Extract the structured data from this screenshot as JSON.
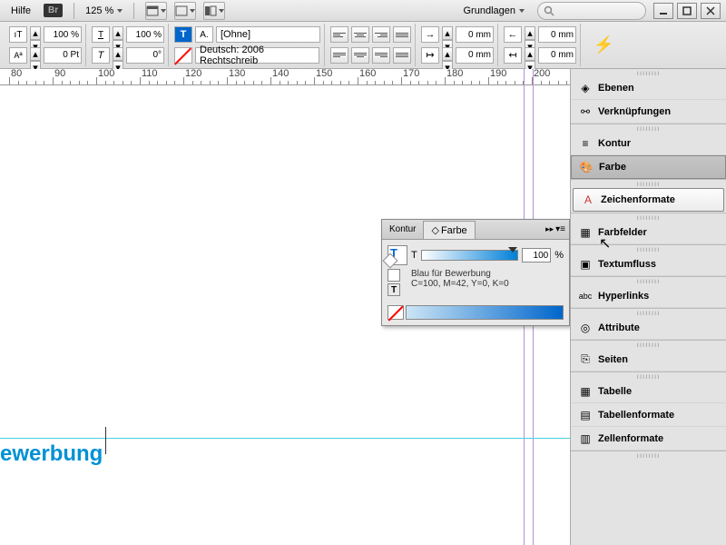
{
  "menu": {
    "hilfe": "Hilfe"
  },
  "br": "Br",
  "zoom": "125 %",
  "workspace_preset": "Grundlagen",
  "toolbar": {
    "size1": "100 %",
    "size2": "100 %",
    "kern": "0 Pt",
    "skew": "0°",
    "ohne": "[Ohne]",
    "lang": "Deutsch: 2006 Rechtschreib",
    "mm": "0 mm"
  },
  "ruler_marks": [
    80,
    90,
    100,
    110,
    120,
    130,
    140,
    150,
    160,
    170,
    180,
    190,
    200
  ],
  "doc_text": "ewerbung",
  "panels": {
    "ebenen": "Ebenen",
    "verknuepfungen": "Verknüpfungen",
    "kontur": "Kontur",
    "farbe": "Farbe",
    "zeichenformate": "Zeichenformate",
    "farbfelder": "Farbfelder",
    "textumfluss": "Textumfluss",
    "hyperlinks": "Hyperlinks",
    "attribute": "Attribute",
    "seiten": "Seiten",
    "tabelle": "Tabelle",
    "tabellenformate": "Tabellenformate",
    "zellenformate": "Zellenformate"
  },
  "color_panel": {
    "tab_kontur": "Kontur",
    "tab_farbe": "Farbe",
    "tint_label": "T",
    "tint_value": "100",
    "tint_pct": "%",
    "swatch_name": "Blau für Bewerbung",
    "swatch_spec": "C=100, M=42, Y=0, K=0"
  }
}
